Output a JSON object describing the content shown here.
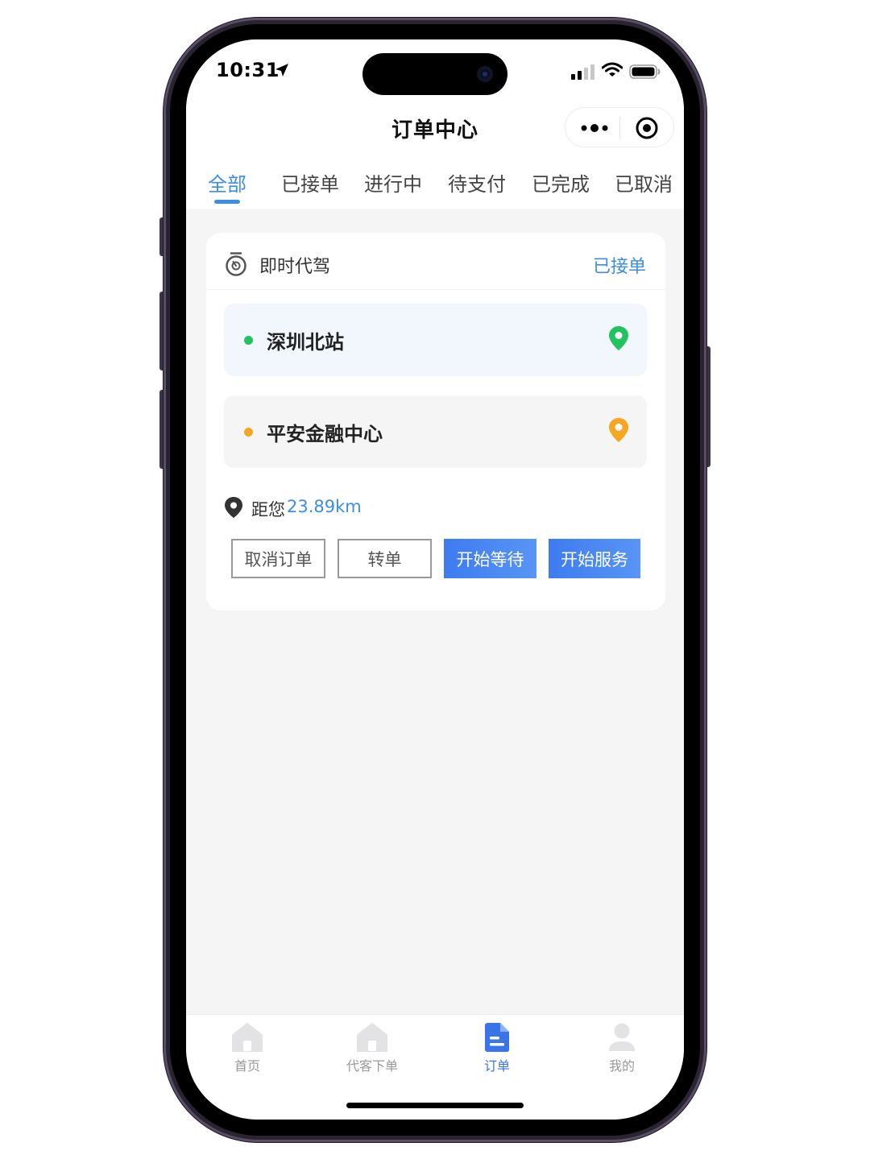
{
  "status_bar": {
    "time": "10:31"
  },
  "nav": {
    "title": "订单中心"
  },
  "tabs": [
    {
      "label": "全部",
      "active": true
    },
    {
      "label": "已接单",
      "active": false
    },
    {
      "label": "进行中",
      "active": false
    },
    {
      "label": "待支付",
      "active": false
    },
    {
      "label": "已完成",
      "active": false
    },
    {
      "label": "已取消",
      "active": false
    }
  ],
  "order": {
    "type": "即时代驾",
    "status": "已接单",
    "start": {
      "name": "深圳北站",
      "color": "#22c35e"
    },
    "end": {
      "name": "平安金融中心",
      "color": "#f5a623"
    },
    "distance_label": "距您",
    "distance_value": "23.89km",
    "actions": [
      "取消订单",
      "转单",
      "开始等待",
      "开始服务"
    ]
  },
  "tabbar": [
    {
      "label": "首页",
      "icon": "home-icon",
      "active": false
    },
    {
      "label": "代客下单",
      "icon": "home-icon",
      "active": false
    },
    {
      "label": "订单",
      "icon": "document-icon",
      "active": true
    },
    {
      "label": "我的",
      "icon": "user-icon",
      "active": false
    }
  ],
  "colors": {
    "accent": "#3a8ee6",
    "primary_button": "#3e7bf0",
    "page_bg": "#f5f5f6"
  }
}
